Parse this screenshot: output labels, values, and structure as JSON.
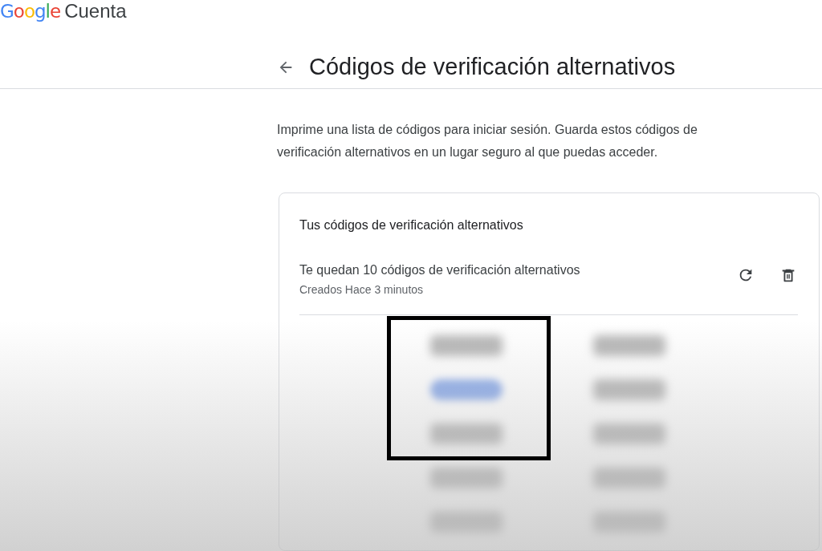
{
  "header": {
    "logo": "Google",
    "product": "Cuenta"
  },
  "page": {
    "title": "Códigos de verificación alternativos",
    "description": "Imprime una lista de códigos para iniciar sesión. Guarda estos códigos de verificación alternativos en un lugar seguro al que puedas acceder."
  },
  "card": {
    "title": "Tus códigos de verificación alternativos",
    "status": "Te quedan 10 códigos de verificación alternativos",
    "created": "Creados Hace 3 minutos",
    "codes": [
      {
        "selected": false
      },
      {
        "selected": true
      },
      {
        "selected": false
      },
      {
        "selected": false
      },
      {
        "selected": false
      },
      {
        "selected": false
      },
      {
        "selected": false
      },
      {
        "selected": false
      },
      {
        "selected": false
      },
      {
        "selected": false
      }
    ]
  },
  "highlight_frame": {
    "shown": true
  }
}
